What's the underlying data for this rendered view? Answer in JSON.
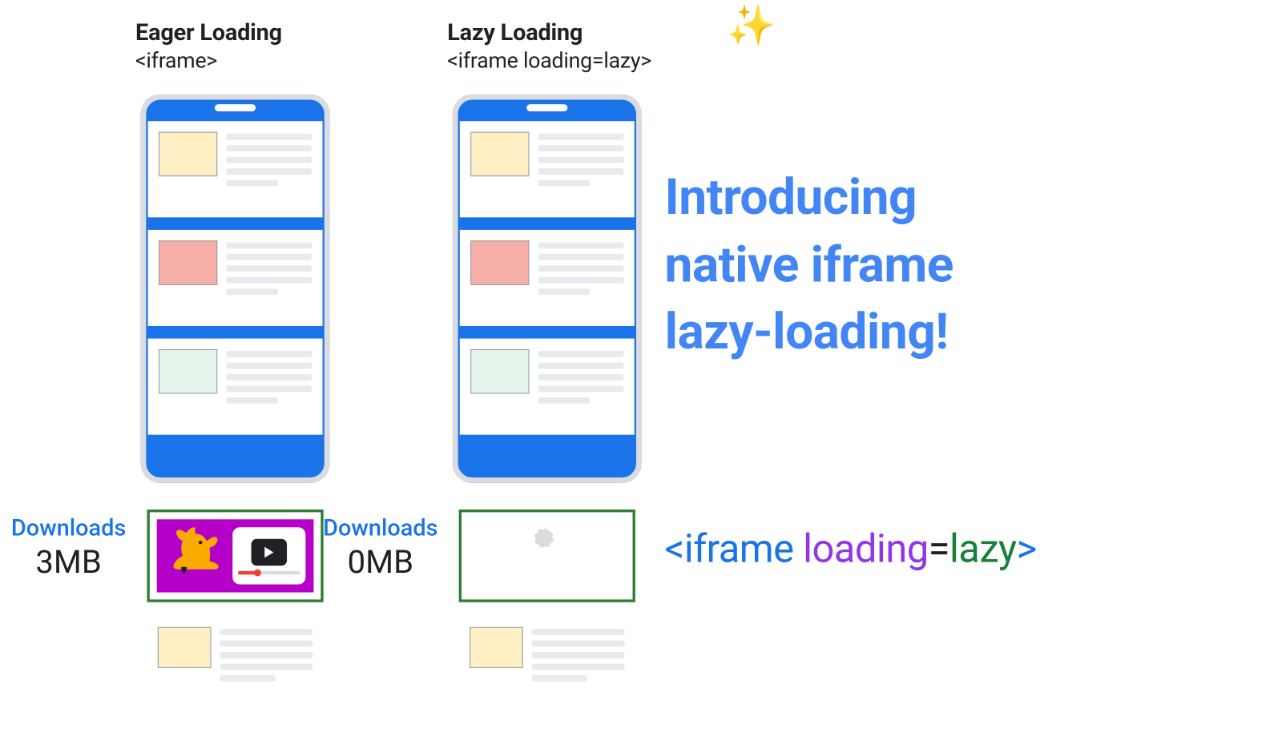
{
  "columns": {
    "eager": {
      "title": "Eager Loading",
      "code": "<iframe>",
      "download_label": "Downloads",
      "download_size": "3MB"
    },
    "lazy": {
      "title": "Lazy Loading",
      "code": "<iframe loading=lazy>",
      "download_label": "Downloads",
      "download_size": "0MB"
    }
  },
  "headline": {
    "line1": "Introducing",
    "line2": "native iframe",
    "line3": "lazy-loading!"
  },
  "code_snippet": {
    "open": "<iframe",
    "attr": "loading",
    "eq": "=",
    "val": "lazy",
    "close": ">"
  },
  "icons": {
    "sparkles": "✨"
  }
}
